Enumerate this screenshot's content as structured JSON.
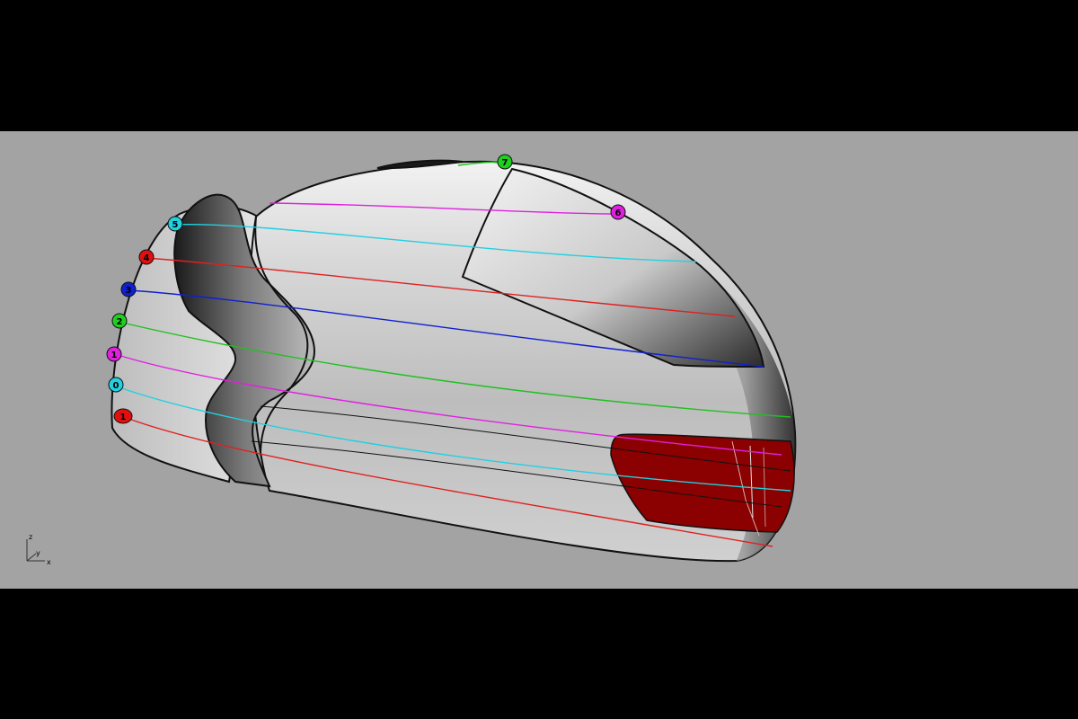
{
  "viewport": {
    "background": "#a3a3a3",
    "letterbox": "#000000"
  },
  "model": {
    "surface_color": "#c8c8c8",
    "outline_color": "#111111",
    "panel_color": "#8b0000"
  },
  "section_markers": [
    {
      "label": "1",
      "color": "#e01010"
    },
    {
      "label": "0",
      "color": "#22d0e0"
    },
    {
      "label": "1",
      "color": "#e020e0"
    },
    {
      "label": "2",
      "color": "#20d020"
    },
    {
      "label": "3",
      "color": "#1020d0"
    },
    {
      "label": "4",
      "color": "#e01010"
    },
    {
      "label": "5",
      "color": "#22d0e0"
    },
    {
      "label": "6",
      "color": "#e020e0"
    },
    {
      "label": "7",
      "color": "#20d020"
    }
  ],
  "axes_widget": {
    "z": "z",
    "y": "y",
    "x": "x"
  }
}
